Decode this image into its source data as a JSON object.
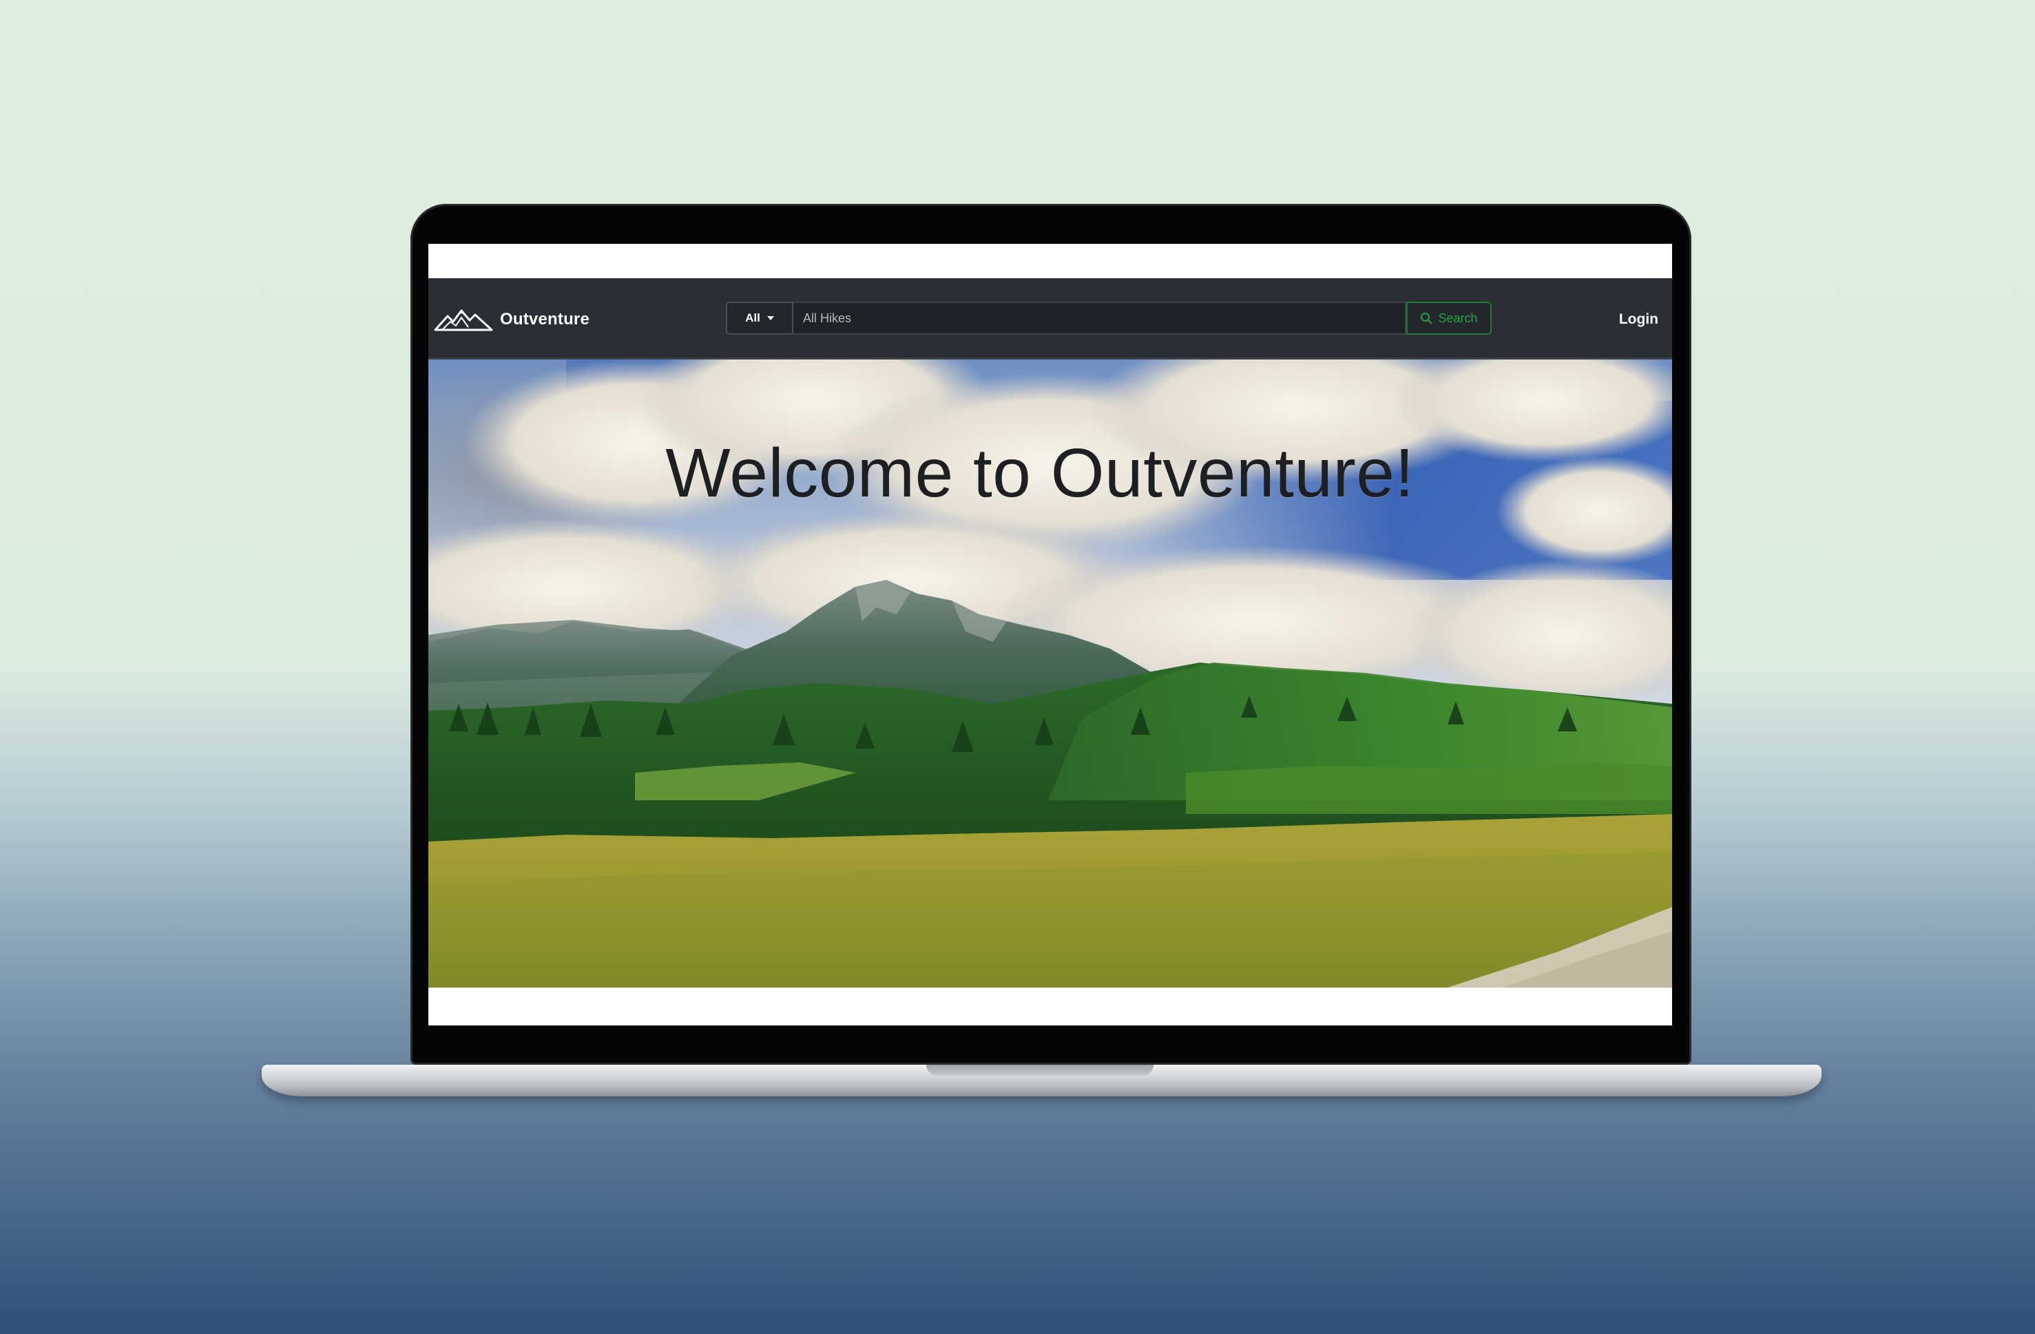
{
  "navbar": {
    "brand_name": "Outventure",
    "brand_icon": "mountain-logo-icon",
    "search": {
      "category_selected": "All",
      "placeholder": "All Hikes",
      "button_label": "Search",
      "button_icon": "search-icon"
    },
    "login_label": "Login"
  },
  "hero": {
    "title": "Welcome to Outventure!",
    "background": "mountain-landscape-photo"
  },
  "colors": {
    "navbar_bg": "#2b2f33",
    "search_accent": "#25a244",
    "title_color": "#1d1f22"
  }
}
